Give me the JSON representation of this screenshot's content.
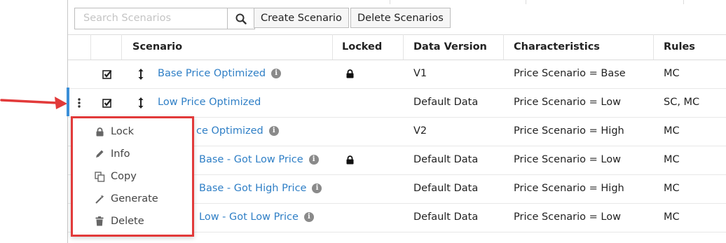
{
  "toolbar": {
    "search_placeholder": "Search Scenarios",
    "create_label": "Create Scenario",
    "delete_label": "Delete Scenarios"
  },
  "columns": {
    "scenario": "Scenario",
    "locked": "Locked",
    "data_version": "Data Version",
    "characteristics": "Characteristics",
    "rules": "Rules"
  },
  "rows": [
    {
      "name": "Base Price Optimized",
      "locked": true,
      "data_version": "V1",
      "characteristics": "Price Scenario = Base",
      "rules": "MC"
    },
    {
      "name": "Low Price Optimized",
      "locked": false,
      "data_version": "Default Data",
      "characteristics": "Price Scenario = Low",
      "rules": "SC, MC"
    },
    {
      "name": "ce Optimized",
      "locked": false,
      "data_version": "V2",
      "characteristics": "Price Scenario = High",
      "rules": "MC"
    },
    {
      "name": "Base - Got Low Price",
      "locked": true,
      "data_version": "Default Data",
      "characteristics": "Price Scenario = Low",
      "rules": "MC"
    },
    {
      "name": "Base - Got High Price",
      "locked": false,
      "data_version": "Default Data",
      "characteristics": "Price Scenario = High",
      "rules": "MC"
    },
    {
      "name": "Low - Got Low Price",
      "locked": false,
      "data_version": "Default Data",
      "characteristics": "Price Scenario = Low",
      "rules": "MC"
    }
  ],
  "context_menu": {
    "items": [
      {
        "label": "Lock",
        "icon": "lock-icon"
      },
      {
        "label": "Info",
        "icon": "pencil-icon"
      },
      {
        "label": "Copy",
        "icon": "copy-icon"
      },
      {
        "label": "Generate",
        "icon": "magic-wand-icon"
      },
      {
        "label": "Delete",
        "icon": "trash-icon"
      }
    ]
  },
  "colors": {
    "link": "#2f7fc6",
    "highlight_border": "#e23a3a",
    "selected_row_bar": "#3b8fd8"
  }
}
